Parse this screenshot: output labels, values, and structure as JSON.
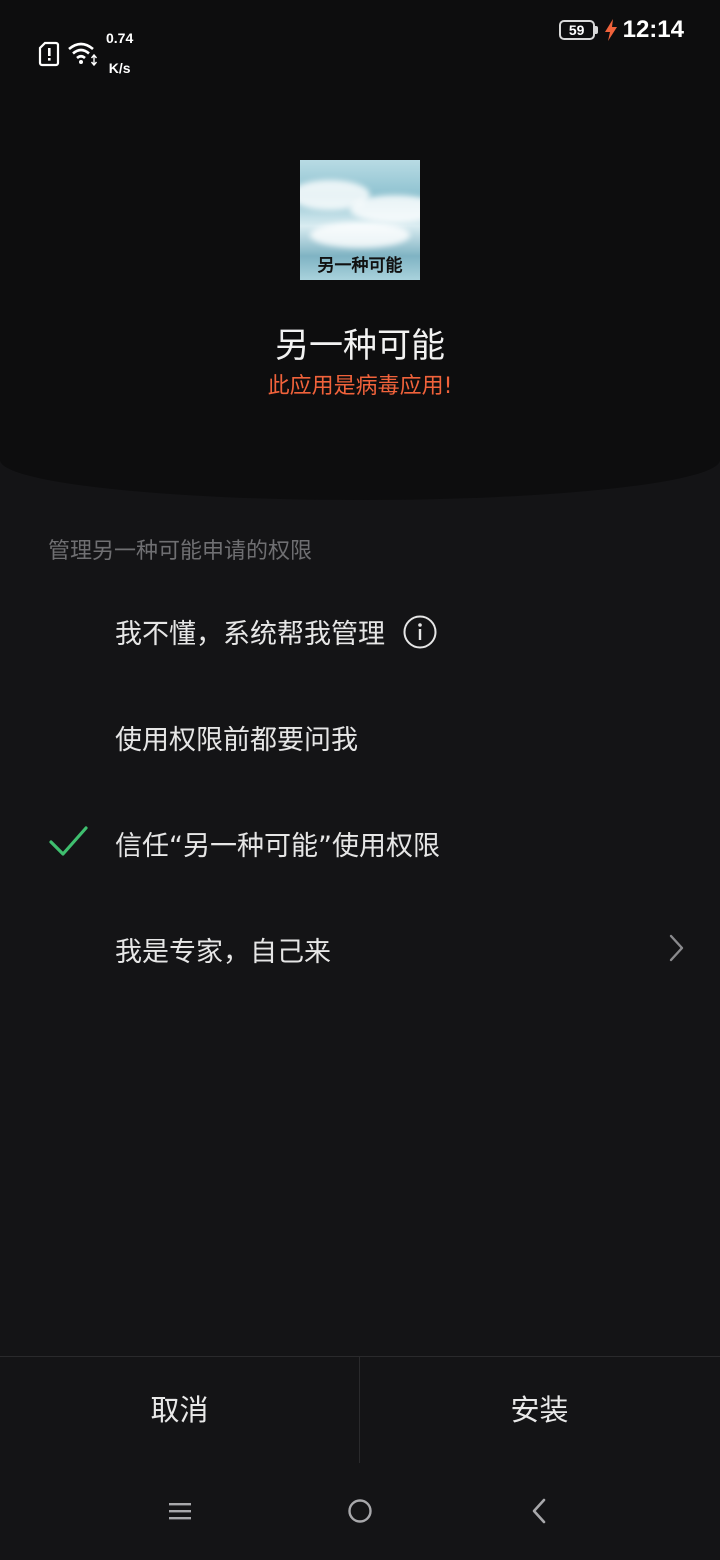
{
  "status_bar": {
    "net_speed_value": "0.74",
    "net_speed_unit": "K/s",
    "battery": "59",
    "time": "12:14",
    "icons": [
      "sim-alert-icon",
      "wifi-icon",
      "charging-icon"
    ]
  },
  "app": {
    "name": "另一种可能",
    "icon_text": "另一种可能",
    "warning": "此应用是病毒应用!"
  },
  "permissions": {
    "title": "管理另一种可能申请的权限",
    "options": [
      {
        "label": "我不懂，系统帮我管理",
        "selected": false,
        "icon": "info-icon"
      },
      {
        "label": "使用权限前都要问我",
        "selected": false
      },
      {
        "label": "信任“另一种可能”使用权限",
        "selected": true
      },
      {
        "label": "我是专家，自己来",
        "selected": false,
        "icon": "chevron-right-icon"
      }
    ]
  },
  "actions": {
    "cancel": "取消",
    "install": "安装"
  },
  "colors": {
    "warning": "#f0623b",
    "check": "#3fbf6f",
    "background": "#141416"
  }
}
